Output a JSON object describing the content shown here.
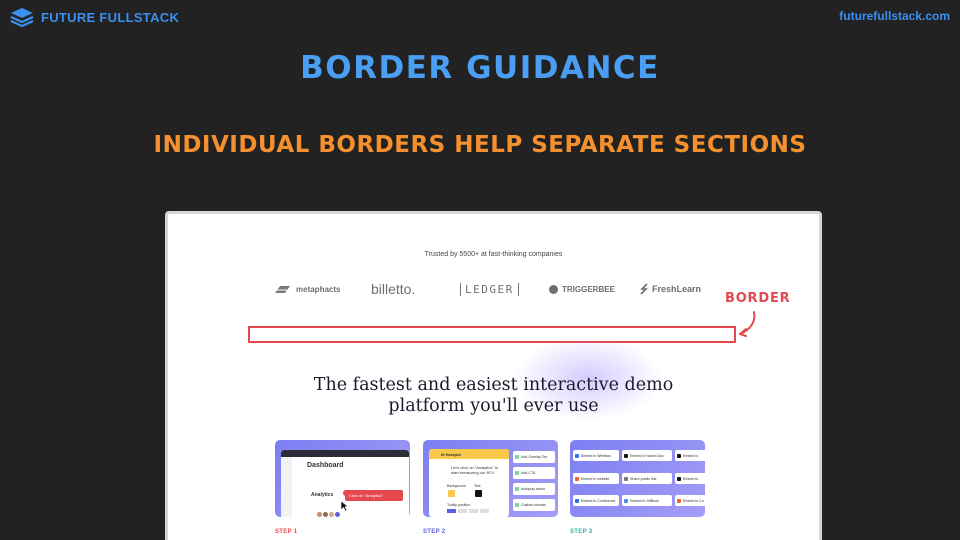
{
  "header": {
    "brand": "FUTURE FULLSTACK",
    "site_url": "futurefullstack.com"
  },
  "slide": {
    "title": "BORDER GUIDANCE",
    "subtitle": "INDIVIDUAL BORDERS HELP SEPARATE SECTIONS"
  },
  "screenshot": {
    "trusted_text": "Trusted by 5500+ at fast-thinking companies",
    "logos": [
      "metaphacts",
      "billetto.",
      "LEDGER",
      "TRIGGERBEE",
      "FreshLearn"
    ],
    "border_label": "BORDER",
    "headline_line1": "The fastest and easiest interactive demo",
    "headline_line2": "platform you'll ever use",
    "cards": [
      {
        "step": "STEP 1",
        "title": "Dashboard",
        "subtitle": "Analytics",
        "tooltip": "Click on \"Analytics\""
      },
      {
        "step": "STEP 2",
        "hotspot_title": "Edit Hotspot",
        "hotspot_text_1": "Let's click on \"Analytics\" to",
        "hotspot_text_2": "start measuring our ROI",
        "label_background": "Background",
        "label_text": "Text",
        "label_tooltip_position": "Tooltip position",
        "actions": [
          "Add Overlay Tex",
          "Add CTA",
          "Autoplay demo",
          "Custom domain"
        ]
      },
      {
        "step": "STEP 3",
        "embeds": [
          "Embed in Webflow",
          "Embed in Notion Doc",
          "Embed in",
          "Embed in website",
          "Share public link",
          "Embed in",
          "Embed in Confluence",
          "Embed in GitBook",
          "Embed in Co"
        ]
      }
    ]
  },
  "colors": {
    "brand_blue": "#3b8ff0",
    "title_blue": "#4a9ff5",
    "subtitle_orange": "#f5902e",
    "border_red": "#e5484d",
    "step1": "#e5484d",
    "step2": "#5b5fe0",
    "step3": "#2bb3a0"
  },
  "icons": [
    "layers-logo-icon",
    "curved-arrow-icon"
  ]
}
